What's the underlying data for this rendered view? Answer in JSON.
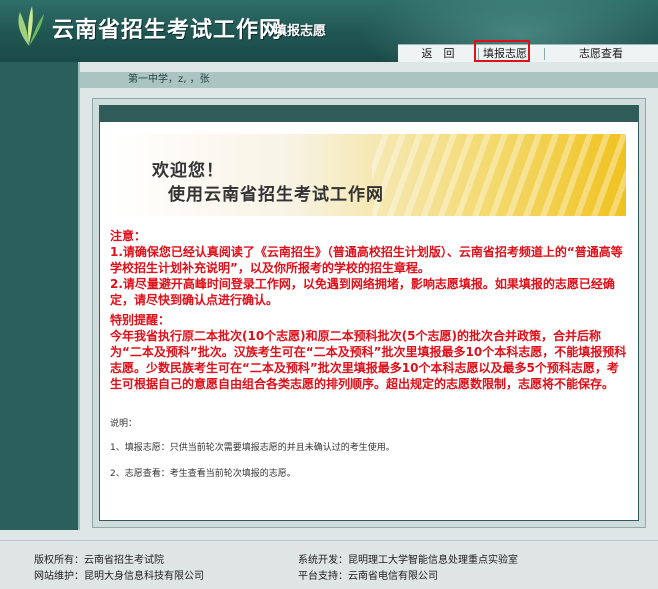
{
  "header": {
    "site_title": "云南省招生考试工作网",
    "sub_title": "填报志愿",
    "nav": {
      "back": "返　回",
      "fill": "填报志愿",
      "view": "志愿查看"
    }
  },
  "info_bar": {
    "text": "第一中学，z,          ，张"
  },
  "banner": {
    "line1": "欢迎您！",
    "line2": "使用云南省招生考试工作网"
  },
  "notice": {
    "title": "注意：",
    "p1": "1.请确保您已经认真阅读了《云南招生》（普通高校招生计划版）、云南省招考频道上的“普通高等学校招生计划补充说明”，以及你所报考的学校的招生章程。",
    "p2": "2.请尽量避开高峰时间登录工作网，以免遇到网络拥堵，影响志愿填报。如果填报的志愿已经确定，请尽快到确认点进行确认。",
    "title2": "特别提醒：",
    "p3": "今年我省执行原二本批次(10个志愿)和原二本预科批次(5个志愿)的批次合并政策，合并后称为“二本及预科”批次。汉族考生可在“二本及预科”批次里填报最多10个本科志愿，不能填报预科志愿。少数民族考生可在“二本及预科”批次里填报最多10个本科志愿以及最多5个预科志愿，考生可根据自己的意愿自由组合各类志愿的排列顺序。超出规定的志愿数限制，志愿将不能保存。"
  },
  "explain": {
    "title": "说明：",
    "item1": "1、填报志愿：只供当前轮次需要填报志愿的并且未确认过的考生使用。",
    "item2": "2、志愿查看：考生查看当前轮次填报的志愿。"
  },
  "footer": {
    "copyright": "版权所有：云南省招生考试院",
    "maintain": "网站维护：昆明大身信息科技有限公司",
    "develop": "系统开发：昆明理工大学智能信息处理重点实验室",
    "platform": "平台支持：云南省电信有限公司"
  },
  "colors": {
    "header": "#205652",
    "notice_red": "#e0101a",
    "highlight": "#e0101a"
  }
}
